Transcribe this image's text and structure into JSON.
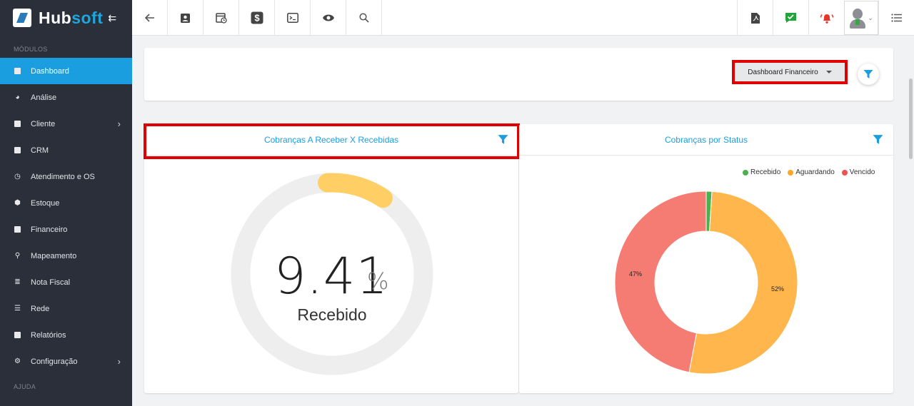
{
  "brand": {
    "hub": "Hub",
    "soft": "soft"
  },
  "sidebar": {
    "section_modules": "MÓDULOS",
    "section_help": "AJUDA",
    "items": [
      {
        "label": "Dashboard",
        "icon": "dashboard-icon",
        "active": true
      },
      {
        "label": "Análise",
        "icon": "pie-chart-icon"
      },
      {
        "label": "Cliente",
        "icon": "contact-card-icon",
        "submenu": true
      },
      {
        "label": "CRM",
        "icon": "crm-board-icon"
      },
      {
        "label": "Atendimento e OS",
        "icon": "calendar-clock-icon"
      },
      {
        "label": "Estoque",
        "icon": "box-icon"
      },
      {
        "label": "Financeiro",
        "icon": "money-icon"
      },
      {
        "label": "Mapeamento",
        "icon": "map-pin-icon"
      },
      {
        "label": "Nota Fiscal",
        "icon": "invoice-icon"
      },
      {
        "label": "Rede",
        "icon": "server-icon"
      },
      {
        "label": "Relatórios",
        "icon": "report-icon"
      },
      {
        "label": "Configuração",
        "icon": "gear-icon",
        "submenu": true
      }
    ]
  },
  "topbar": {
    "left_buttons": [
      "back-arrow-icon",
      "contact-card-icon",
      "calendar-clock-icon",
      "dollar-icon",
      "terminal-icon",
      "eye-icon",
      "search-icon"
    ],
    "right_buttons": [
      "pdf-icon",
      "check-chat-icon",
      "alarm-bell-icon",
      "user-avatar",
      "list-menu-icon"
    ]
  },
  "filter_bar": {
    "dashboard_select": "Dashboard Financeiro"
  },
  "gauge_card": {
    "title": "Cobranças A Receber X Recebidas",
    "value": "9.41",
    "unit": "%",
    "label": "Recebido",
    "fraction": 0.0941
  },
  "status_card": {
    "title": "Cobranças por Status"
  },
  "chart_data": {
    "type": "pie",
    "title": "Cobranças por Status",
    "legend_position": "top-right",
    "labels": [
      "Recebido",
      "Aguardando",
      "Vencido"
    ],
    "values": [
      1,
      52,
      47
    ],
    "slice_labels": [
      "",
      "52%",
      "47%"
    ],
    "colors": [
      "#4caf50",
      "#ffb74d",
      "#f47c72"
    ]
  },
  "colors": {
    "accent": "#1a9ee0",
    "highlight": "#e00000",
    "sidebar": "#2a2f3a"
  }
}
